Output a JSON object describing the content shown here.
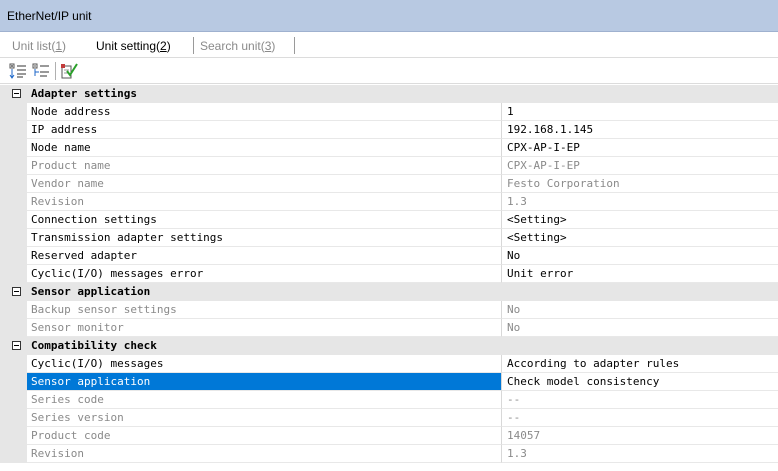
{
  "window": {
    "title": "EtherNet/IP unit"
  },
  "tabs": [
    {
      "label": "Unit list(",
      "key": "1",
      "end": ")",
      "active": false
    },
    {
      "label": "Unit setting(",
      "key": "2",
      "end": ")",
      "active": true
    },
    {
      "label": "Search unit(",
      "key": "3",
      "end": ")",
      "active": false
    }
  ],
  "toolbar": {
    "icons": [
      "sort-by-category-icon",
      "sort-alphabetical-icon",
      "edit-check-icon"
    ]
  },
  "colors": {
    "title_bar": "#b8c9e2",
    "selection": "#0078d7",
    "category_bg": "#e6e6e6",
    "readonly_text": "#8a8a8a"
  },
  "grid": {
    "categories": [
      {
        "label": "Adapter settings",
        "rows": [
          {
            "name": "Node address",
            "value": "1",
            "readonly": false
          },
          {
            "name": "IP address",
            "value": "192.168.1.145",
            "readonly": false
          },
          {
            "name": "Node name",
            "value": "CPX-AP-I-EP",
            "readonly": false
          },
          {
            "name": "Product name",
            "value": "CPX-AP-I-EP",
            "readonly": true
          },
          {
            "name": "Vendor name",
            "value": "Festo Corporation",
            "readonly": true
          },
          {
            "name": "Revision",
            "value": "1.3",
            "readonly": true
          },
          {
            "name": "Connection settings",
            "value": "<Setting>",
            "readonly": false
          },
          {
            "name": "Transmission adapter settings",
            "value": "<Setting>",
            "readonly": false
          },
          {
            "name": "Reserved adapter",
            "value": "No",
            "readonly": false
          },
          {
            "name": "Cyclic(I/O) messages error",
            "value": "Unit error",
            "readonly": false
          }
        ]
      },
      {
        "label": "Sensor application",
        "rows": [
          {
            "name": "Backup sensor settings",
            "value": "No",
            "readonly": true
          },
          {
            "name": "Sensor monitor",
            "value": "No",
            "readonly": true
          }
        ]
      },
      {
        "label": "Compatibility check",
        "rows": [
          {
            "name": "Cyclic(I/O) messages",
            "value": "According to adapter rules",
            "readonly": false
          },
          {
            "name": "Sensor application",
            "value": "Check model consistency",
            "readonly": false,
            "selected": true
          },
          {
            "name": "Series code",
            "value": "--",
            "readonly": true
          },
          {
            "name": "Series version",
            "value": "--",
            "readonly": true
          },
          {
            "name": "Product code",
            "value": "14057",
            "readonly": true
          },
          {
            "name": "Revision",
            "value": "1.3",
            "readonly": true
          }
        ]
      }
    ]
  }
}
